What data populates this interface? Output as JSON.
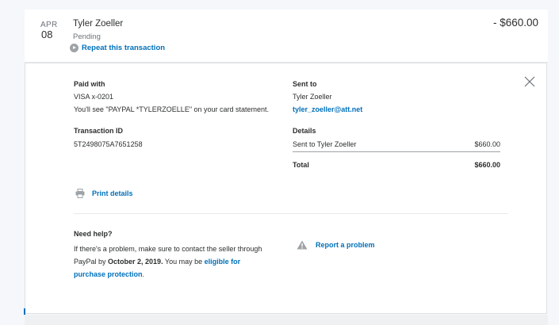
{
  "transaction": {
    "month": "APR",
    "day": "08",
    "payee": "Tyler Zoeller",
    "status": "Pending",
    "repeat_label": "Repeat this transaction",
    "amount": "- $660.00"
  },
  "details": {
    "paid_with_label": "Paid with",
    "card": "VISA x-0201",
    "statement_note": "You'll see \"PAYPAL *TYLERZOELLE\" on your card statement.",
    "transaction_id_label": "Transaction ID",
    "transaction_id": "5T2498075A7651258",
    "sent_to_label": "Sent to",
    "recipient_name": "Tyler Zoeller",
    "recipient_email": "tyler_zoeller@att.net",
    "details_label": "Details",
    "detail_line_label": "Sent to Tyler Zoeller",
    "detail_line_amount": "$660.00",
    "total_label": "Total",
    "total_amount": "$660.00",
    "print_label": "Print details"
  },
  "help": {
    "title": "Need help?",
    "text_1": "If there's a problem, make sure to contact the seller through PayPal by ",
    "deadline": "October 2, 2019.",
    "text_2": " You may be ",
    "protection_link": "eligible for purchase protection",
    "text_3": ".",
    "report_label": "Report a problem"
  },
  "icons": {
    "repeat": "repeat-icon",
    "close": "close-icon",
    "print": "printer-icon",
    "report": "warning-icon"
  },
  "colors": {
    "link": "#0070ba",
    "muted": "#6c7378",
    "text": "#2c2e2f",
    "background": "#f5f7fa"
  }
}
